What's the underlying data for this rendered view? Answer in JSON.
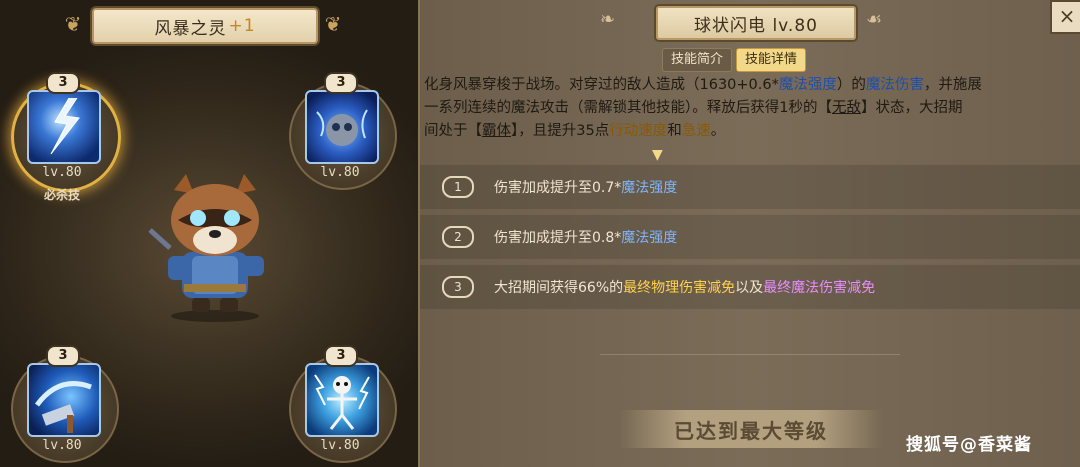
{
  "spirit_panel": {
    "title": "风暴之灵",
    "title_plus": "+1",
    "slots": [
      {
        "count": "3",
        "level": "lv.80",
        "tag": "必杀技",
        "icon": "lightning-bolt-icon",
        "selected": true
      },
      {
        "count": "3",
        "level": "lv.80",
        "icon": "raccoon-storm-icon"
      },
      {
        "count": "3",
        "level": "lv.80",
        "icon": "storm-hammer-icon"
      },
      {
        "count": "3",
        "level": "lv.80",
        "icon": "skeleton-shock-icon"
      }
    ]
  },
  "skill_panel": {
    "title": "球状闪电  lv.80",
    "tabs": {
      "intro": "技能简介",
      "details": "技能详情"
    },
    "close_icon": "×",
    "description": {
      "p1": "化身风暴穿梭于战场。对穿过的敌人造成（1630+0.6*",
      "p1_magic_power": "魔法强度",
      "p2": "）的",
      "p2_magic_damage": "魔法伤害",
      "p3": "，并施展",
      "p4": "一系列连续的魔法攻击（需解锁其他技能）。释放后获得1秒的【",
      "p4_invincible": "无敌",
      "p5": "】状态，大招期",
      "p6": "间处于【",
      "p6_hegemony": "霸体",
      "p7": "】，且提升35点",
      "p7_move_speed": "行动速度",
      "p8": "和",
      "p8_haste": "急速",
      "p9": "。"
    },
    "upgrades": [
      {
        "num": "1",
        "text": "伤害加成提升至0.7*",
        "highlight": "魔法强度"
      },
      {
        "num": "2",
        "text": "伤害加成提升至0.8*",
        "highlight": "魔法强度"
      },
      {
        "num": "3",
        "text": "大招期间获得66%的",
        "gold": "最终物理伤害减免",
        "mid": "以及",
        "pink": "最终魔法伤害减免"
      }
    ],
    "max_level": "已达到最大等级"
  },
  "watermark": "搜狐号@香菜酱",
  "colors": {
    "magic_blue": "#1f4fa8",
    "gold": "#ffd24a",
    "pink": "#e88cff",
    "selected_glow": "#e2b144"
  }
}
